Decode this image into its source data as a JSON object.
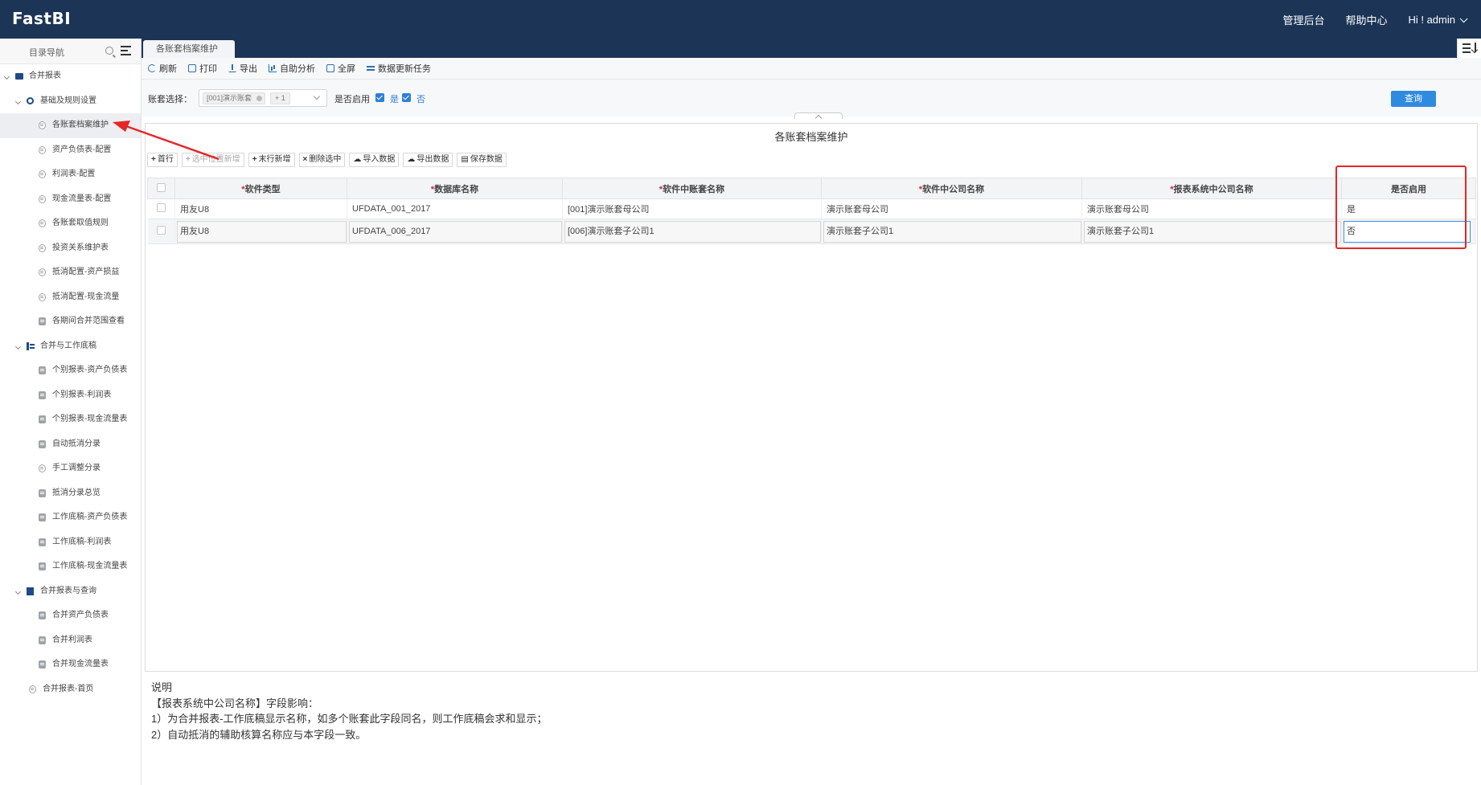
{
  "app": {
    "logo": "FastBI",
    "nav": {
      "admin": "管理后台",
      "help": "帮助中心",
      "user": "Hi ! admin"
    }
  },
  "sidebar": {
    "search_label": "目录导航",
    "items": [
      {
        "label": "合并报表",
        "level": 0,
        "icon": "folder-icon"
      },
      {
        "label": "基础及规则设置",
        "level": 1,
        "icon": "gear-icon"
      },
      {
        "label": "各账套档案维护",
        "level": 2,
        "icon": "round"
      },
      {
        "label": "资产负债表-配置",
        "level": 2,
        "icon": "round"
      },
      {
        "label": "利润表-配置",
        "level": 2,
        "icon": "round"
      },
      {
        "label": "现金流量表-配置",
        "level": 2,
        "icon": "round"
      },
      {
        "label": "各账套取值规则",
        "level": 2,
        "icon": "round"
      },
      {
        "label": "投资关系维护表",
        "level": 2,
        "icon": "round"
      },
      {
        "label": "抵消配置-资产损益",
        "level": 2,
        "icon": "round"
      },
      {
        "label": "抵消配置-现金流量",
        "level": 2,
        "icon": "round"
      },
      {
        "label": "各期间合并范围查看",
        "level": 2,
        "icon": "square"
      },
      {
        "label": "合并与工作底稿",
        "level": 1,
        "icon": "list-icon"
      },
      {
        "label": "个别报表-资产负债表",
        "level": 2,
        "icon": "square"
      },
      {
        "label": "个别报表-利润表",
        "level": 2,
        "icon": "square"
      },
      {
        "label": "个别报表-现金流量表",
        "level": 2,
        "icon": "square"
      },
      {
        "label": "自动抵消分录",
        "level": 2,
        "icon": "square"
      },
      {
        "label": "手工调整分录",
        "level": 2,
        "icon": "round"
      },
      {
        "label": "抵消分录总览",
        "level": 2,
        "icon": "square"
      },
      {
        "label": "工作底稿-资产负债表",
        "level": 2,
        "icon": "square"
      },
      {
        "label": "工作底稿-利润表",
        "level": 2,
        "icon": "square"
      },
      {
        "label": "工作底稿-现金流量表",
        "level": 2,
        "icon": "square"
      },
      {
        "label": "合并报表与查询",
        "level": 1,
        "icon": "doc-icon"
      },
      {
        "label": "合并资产负债表",
        "level": 2,
        "icon": "square"
      },
      {
        "label": "合并利润表",
        "level": 2,
        "icon": "square"
      },
      {
        "label": "合并现金流量表",
        "level": 2,
        "icon": "square"
      },
      {
        "label": "合并报表-首页",
        "level": 1,
        "icon": "round"
      }
    ]
  },
  "tabs": {
    "active": "各账套档案维护"
  },
  "toolbar": {
    "refresh": "刷新",
    "print": "打印",
    "export": "导出",
    "analysis": "自助分析",
    "fullscreen": "全屏",
    "update_task": "数据更新任务"
  },
  "filters": {
    "account_label": "账套选择：",
    "account_tag": "[001]演示账套",
    "account_more": "+ 1",
    "enabled_label": "是否启用",
    "yes": "是",
    "no": "否",
    "query": "查询"
  },
  "panel": {
    "title": "各账套档案维护",
    "buttons": {
      "first_row": "首行",
      "insert_at": "选中位置新增",
      "append": "末行新增",
      "delete": "删除选中",
      "import": "导入数据",
      "export": "导出数据",
      "save": "保存数据"
    },
    "columns": [
      "软件类型",
      "数据库名称",
      "软件中账套名称",
      "软件中公司名称",
      "报表系统中公司名称",
      "是否启用"
    ],
    "rows": [
      [
        "用友U8",
        "UFDATA_001_2017",
        "[001]演示账套母公司",
        "演示账套母公司",
        "演示账套母公司",
        "是"
      ],
      [
        "用友U8",
        "UFDATA_006_2017",
        "[006]演示账套子公司1",
        "演示账套子公司1",
        "演示账套子公司1",
        "否"
      ]
    ]
  },
  "notes": {
    "title": "说明",
    "line1": "【报表系统中公司名称】字段影响：",
    "line2": "1）为合并报表-工作底稿显示名称，如多个账套此字段同名，则工作底稿会求和显示；",
    "line3": "2）自动抵消的辅助核算名称应与本字段一致。"
  },
  "colors": {
    "header": "#1c3557",
    "accent": "#2f8be0",
    "annotation": "#e42727"
  }
}
